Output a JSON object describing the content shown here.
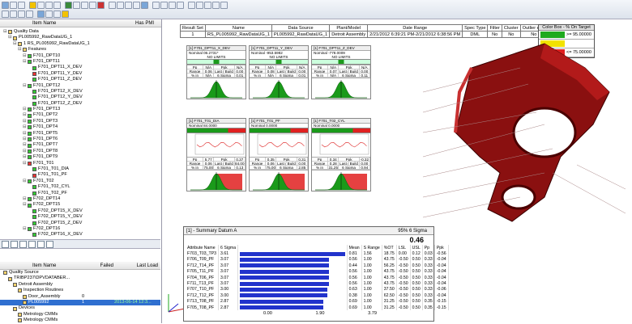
{
  "left_tree": {
    "col_item": "Item Name",
    "col_pmi": "Has PMI",
    "nodes": [
      {
        "label": "Quality Data",
        "level": 0,
        "icon": "f"
      },
      {
        "label": "PL005992_RawDataUG_1",
        "level": 1,
        "icon": "f"
      },
      {
        "label": "1 RS_PL005992_RawDataUG_1",
        "level": 2,
        "icon": "f"
      },
      {
        "label": "Features",
        "level": 3,
        "icon": "f"
      },
      {
        "label": "F701_DPT10",
        "level": 4,
        "icon": "g"
      },
      {
        "label": "F701_DPT11",
        "level": 4,
        "icon": "g"
      },
      {
        "label": "F701_DPT11_X_DEV",
        "level": 5,
        "icon": "g"
      },
      {
        "label": "F701_DPT11_Y_DEV",
        "level": 5,
        "icon": "r"
      },
      {
        "label": "F701_DPT11_Z_DEV",
        "level": 5,
        "icon": "g"
      },
      {
        "label": "F701_DPT12",
        "level": 4,
        "icon": "g"
      },
      {
        "label": "F701_DPT12_X_DEV",
        "level": 5,
        "icon": "g"
      },
      {
        "label": "F701_DPT12_Y_DEV",
        "level": 5,
        "icon": "g"
      },
      {
        "label": "F701_DPT12_Z_DEV",
        "level": 5,
        "icon": "g"
      },
      {
        "label": "F701_DPT13",
        "level": 4,
        "icon": "g"
      },
      {
        "label": "F701_DPT2",
        "level": 4,
        "icon": "g"
      },
      {
        "label": "F701_DPT3",
        "level": 4,
        "icon": "g"
      },
      {
        "label": "F701_DPT4",
        "level": 4,
        "icon": "g"
      },
      {
        "label": "F701_DPT5",
        "level": 4,
        "icon": "g"
      },
      {
        "label": "F701_DPT6",
        "level": 4,
        "icon": "g"
      },
      {
        "label": "F701_DPT7",
        "level": 4,
        "icon": "g"
      },
      {
        "label": "F701_DPT8",
        "level": 4,
        "icon": "g"
      },
      {
        "label": "F701_DPT9",
        "level": 4,
        "icon": "g"
      },
      {
        "label": "F701_T01",
        "level": 4,
        "icon": "r"
      },
      {
        "label": "F701_T01_DIA",
        "level": 5,
        "icon": "g"
      },
      {
        "label": "F701_T01_PF",
        "level": 5,
        "icon": "r"
      },
      {
        "label": "F701_T02",
        "level": 4,
        "icon": "g"
      },
      {
        "label": "F701_T02_CYL",
        "level": 5,
        "icon": "g"
      },
      {
        "label": "F701_T02_PF",
        "level": 5,
        "icon": "g"
      },
      {
        "label": "F702_DPT14",
        "level": 4,
        "icon": "g"
      },
      {
        "label": "F702_DPT15",
        "level": 4,
        "icon": "g"
      },
      {
        "label": "F702_DPT15_X_DEV",
        "level": 5,
        "icon": "g"
      },
      {
        "label": "F702_DPT15_Y_DEV",
        "level": 5,
        "icon": "g"
      },
      {
        "label": "F702_DPT15_Z_DEV",
        "level": 5,
        "icon": "g"
      },
      {
        "label": "F702_DPT16",
        "level": 4,
        "icon": "g"
      },
      {
        "label": "F702_DPT16_X_DEV",
        "level": 5,
        "icon": "g"
      }
    ]
  },
  "lower_tree": {
    "col_item": "Item Name",
    "col_failed": "Failed",
    "col_last": "Last Load",
    "nodes": [
      {
        "label": "Quality Source",
        "level": 0
      },
      {
        "label": "TRIBP237\\DPVDATABER...",
        "level": 1
      },
      {
        "label": "Detroit Assembly",
        "level": 2
      },
      {
        "label": "Inspection Routines",
        "level": 3
      },
      {
        "label": "Door_Assembly",
        "level": 4,
        "failed": "0"
      },
      {
        "label": "PL005992",
        "level": 4,
        "failed": "1",
        "last": "2013-06-14 12:3...",
        "selected": true
      },
      {
        "label": "Devices",
        "level": 2
      },
      {
        "label": "Metrology CMMs",
        "level": 3
      },
      {
        "label": "Metrology CMMs",
        "level": 3
      }
    ]
  },
  "result_table": {
    "headers": [
      "Result Set",
      "Name",
      "Data Source",
      "Plant/Model",
      "Date Range",
      "Spec Type",
      "Filter",
      "Cluster",
      "Outlier exc.",
      "Flt by Trcd"
    ],
    "row": [
      "1",
      "RS_PL005992_RawDataUG_1",
      "PL005992_RawDataUG_1",
      "Detroit Assembly",
      "2/21/2012 6:39:21 PM-2/21/2012 6:38:56 PM",
      "DML",
      "No",
      "No",
      "No",
      ""
    ]
  },
  "legend": {
    "title": "Color Box - % On Target",
    "rows": [
      {
        "color": "#1faa1f",
        "label": ">= 95.00000"
      },
      {
        "color": "#f2e200",
        "label": ""
      },
      {
        "color": "#e02020",
        "label": "<= 75.00000"
      }
    ]
  },
  "cards_top": [
    {
      "title": "[1] F701_DPT11_X_DEV",
      "nominal": "Nominal  06.2731*",
      "limits": "NO LIMITS",
      "r1": [
        "Pp",
        "N/A",
        "Ppk",
        "N/A"
      ],
      "r2": [
        "Range",
        "0.06",
        "Last / Build",
        "0.00"
      ],
      "r3": [
        "% in Spec",
        "N/A",
        "6 Sigma",
        "0.01"
      ]
    },
    {
      "title": "[1] F701_DPT11_Y_DEV",
      "nominal": "Nominal  -953.5982",
      "limits": "NO LIMITS",
      "r1": [
        "Pp",
        "N/A",
        "Ppk",
        "N/A"
      ],
      "r2": [
        "Range",
        "0.08",
        "Last / Build",
        "0.00"
      ],
      "r3": [
        "% in Spec",
        "N/A",
        "6 Sigma",
        "0.01"
      ]
    },
    {
      "title": "[1] F701_DPT11_Z_DEV",
      "nominal": "Nominal  -778.0009",
      "limits": "NO LIMITS",
      "r1": [
        "Pp",
        "N/A",
        "Ppk",
        "N/A"
      ],
      "r2": [
        "Range",
        "0.07",
        "Last / Build",
        "0.00"
      ],
      "r3": [
        "% in Spec",
        "N/A",
        "6 Sigma",
        "0.11"
      ]
    }
  ],
  "cards_mid": [
    {
      "title": "[1] F701_T01_DIA",
      "nominal": "Nominal  84.0000",
      "r1": [
        "Pp",
        "5.77",
        "Ppk",
        "0.37"
      ],
      "r2": [
        "Range",
        "0.06",
        "Last / Build",
        "84.00"
      ],
      "r3": [
        "% in Spec",
        "75.00",
        "6 Sigma",
        "0.13"
      ]
    },
    {
      "title": "[1] F701_T01_PF",
      "nominal": "Nominal  0.0000",
      "r1": [
        "Pp",
        "0.35",
        "Ppk",
        "0.31"
      ],
      "r2": [
        "Range",
        "0.06",
        "Last / Build",
        "0.00"
      ],
      "r3": [
        "% in Spec",
        "75.00",
        "6 Sigma",
        "2.85"
      ]
    },
    {
      "title": "[1] F701_T02_CYL",
      "nominal": "Nominal  0.0000",
      "r1": [
        "Pp",
        "0.34",
        "Ppk",
        "-0.32"
      ],
      "r2": [
        "Range",
        "0.28",
        "Last / Build",
        "0.00"
      ],
      "r3": [
        "% in Spec",
        "31.25",
        "6 Sigma",
        "0.94"
      ]
    }
  ],
  "summary": {
    "title": "[1] - Summary Datum A",
    "pct": "95%",
    "sigma_label": "6 Sigma",
    "sigma_value": "0.46",
    "headers": [
      "Attribute Name",
      "6 Sigma",
      "",
      "Mean",
      "S Range",
      "%OT",
      "LSL",
      "USL",
      "Pp",
      "Ppk"
    ],
    "rows": [
      [
        "F703_T03_TP3",
        "3.61",
        "0.81",
        "1.56",
        "18.75",
        "0.00",
        "0.12",
        "0.03",
        "-0.56"
      ],
      [
        "F706_T09_PF",
        "3.07",
        "0.56",
        "1.00",
        "43.75",
        "-0.50",
        "0.50",
        "0.33",
        "-0.04"
      ],
      [
        "F712_T14_PF",
        "3.07",
        "0.44",
        "1.00",
        "56.25",
        "-0.50",
        "0.50",
        "0.33",
        "-0.04"
      ],
      [
        "F705_T11_PF",
        "3.07",
        "0.56",
        "1.00",
        "43.75",
        "-0.50",
        "0.50",
        "0.33",
        "-0.04"
      ],
      [
        "F704_T06_PF",
        "3.07",
        "0.56",
        "1.00",
        "43.75",
        "-0.50",
        "0.50",
        "0.33",
        "-0.04"
      ],
      [
        "F711_T13_PF",
        "3.07",
        "0.56",
        "1.00",
        "43.75",
        "-0.50",
        "0.50",
        "0.33",
        "-0.04"
      ],
      [
        "F707_T10_PF",
        "3.00",
        "0.63",
        "1.00",
        "37.50",
        "-0.50",
        "0.50",
        "0.33",
        "-0.06"
      ],
      [
        "F712_T12_PF",
        "3.00",
        "0.38",
        "1.00",
        "62.50",
        "-0.50",
        "0.50",
        "0.33",
        "-0.04"
      ],
      [
        "F713_T08_PF",
        "2.87",
        "0.69",
        "1.00",
        "31.25",
        "-0.50",
        "0.50",
        "0.35",
        "-0.15"
      ],
      [
        "F705_T08_PF",
        "2.87",
        "0.69",
        "1.00",
        "31.25",
        "-0.50",
        "0.50",
        "0.35",
        "-0.15"
      ]
    ],
    "bar_values": [
      3.61,
      3.07,
      3.07,
      3.07,
      3.07,
      3.07,
      3.0,
      3.0,
      2.87,
      2.87
    ],
    "axis": [
      "0.00",
      "1.90",
      "3.79"
    ]
  }
}
